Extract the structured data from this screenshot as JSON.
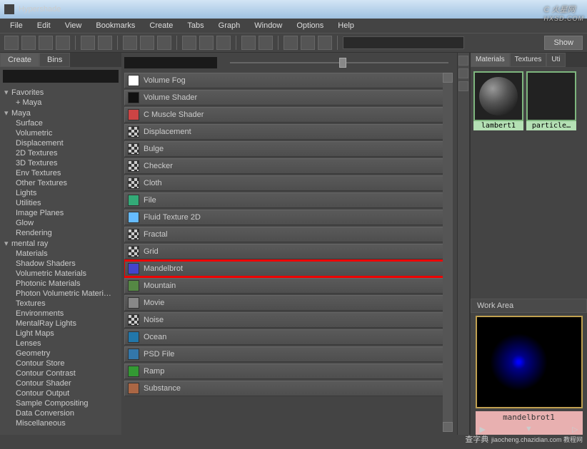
{
  "window": {
    "title": "Hypershade"
  },
  "menu": [
    "File",
    "Edit",
    "View",
    "Bookmarks",
    "Create",
    "Tabs",
    "Graph",
    "Window",
    "Options",
    "Help"
  ],
  "show_btn": "Show",
  "left_tabs": {
    "create": "Create",
    "bins": "Bins"
  },
  "tree": [
    {
      "t": "Favorites",
      "hdr": true,
      "exp": "▾"
    },
    {
      "t": "+ Maya",
      "sub": true
    },
    {
      "t": "Maya",
      "hdr": true,
      "exp": "▾"
    },
    {
      "t": "Surface",
      "sub": true
    },
    {
      "t": "Volumetric",
      "sub": true
    },
    {
      "t": "Displacement",
      "sub": true
    },
    {
      "t": "2D Textures",
      "sub": true
    },
    {
      "t": "3D Textures",
      "sub": true
    },
    {
      "t": "Env Textures",
      "sub": true
    },
    {
      "t": "Other Textures",
      "sub": true
    },
    {
      "t": "Lights",
      "sub": true
    },
    {
      "t": "Utilities",
      "sub": true
    },
    {
      "t": "Image Planes",
      "sub": true
    },
    {
      "t": "Glow",
      "sub": true
    },
    {
      "t": "Rendering",
      "sub": true
    },
    {
      "t": "mental ray",
      "hdr": true,
      "exp": "▾"
    },
    {
      "t": "Materials",
      "sub": true
    },
    {
      "t": "Shadow Shaders",
      "sub": true
    },
    {
      "t": "Volumetric Materials",
      "sub": true
    },
    {
      "t": "Photonic Materials",
      "sub": true
    },
    {
      "t": "Photon Volumetric Materi…",
      "sub": true
    },
    {
      "t": "Textures",
      "sub": true
    },
    {
      "t": "Environments",
      "sub": true
    },
    {
      "t": "MentalRay Lights",
      "sub": true
    },
    {
      "t": "Light Maps",
      "sub": true
    },
    {
      "t": "Lenses",
      "sub": true
    },
    {
      "t": "Geometry",
      "sub": true
    },
    {
      "t": "Contour Store",
      "sub": true
    },
    {
      "t": "Contour Contrast",
      "sub": true
    },
    {
      "t": "Contour Shader",
      "sub": true
    },
    {
      "t": "Contour Output",
      "sub": true
    },
    {
      "t": "Sample Compositing",
      "sub": true
    },
    {
      "t": "Data Conversion",
      "sub": true
    },
    {
      "t": "Miscellaneous",
      "sub": true
    }
  ],
  "nodes": [
    {
      "label": "Volume Fog",
      "c": "#fff"
    },
    {
      "label": "Volume Shader",
      "c": "#111"
    },
    {
      "label": "C Muscle Shader",
      "c": "#c44"
    },
    {
      "label": "Displacement",
      "c": "#999",
      "ck": true
    },
    {
      "label": "Bulge",
      "c": "#888",
      "ck": true
    },
    {
      "label": "Checker",
      "c": "#999",
      "ck": true
    },
    {
      "label": "Cloth",
      "c": "#aaa",
      "ck": true
    },
    {
      "label": "File",
      "c": "#3a7"
    },
    {
      "label": "Fluid Texture 2D",
      "c": "#6bf"
    },
    {
      "label": "Fractal",
      "c": "#888",
      "ck": true
    },
    {
      "label": "Grid",
      "c": "#999",
      "ck": true
    },
    {
      "label": "Mandelbrot",
      "c": "#44c",
      "hl": true
    },
    {
      "label": "Mountain",
      "c": "#584"
    },
    {
      "label": "Movie",
      "c": "#888"
    },
    {
      "label": "Noise",
      "c": "#777",
      "ck": true
    },
    {
      "label": "Ocean",
      "c": "#27a"
    },
    {
      "label": "PSD File",
      "c": "#37a"
    },
    {
      "label": "Ramp",
      "c": "#393"
    },
    {
      "label": "Substance",
      "c": "#a64"
    }
  ],
  "right_tabs": [
    "Materials",
    "Textures",
    "Uti"
  ],
  "swatches": [
    {
      "label": "lambert1",
      "kind": "sphere"
    },
    {
      "label": "particle…",
      "kind": "teal"
    }
  ],
  "workarea": {
    "title": "Work Area",
    "node_label": "mandelbrot1",
    "play_l": "▶",
    "play_m": "▼",
    "play_r": "▷"
  },
  "watermark": {
    "big": "C 火星网",
    "small": "HXSD.COM"
  },
  "bottommark": {
    "big": "查字典",
    "small": "jiaocheng.chazidian.com  教程网"
  }
}
